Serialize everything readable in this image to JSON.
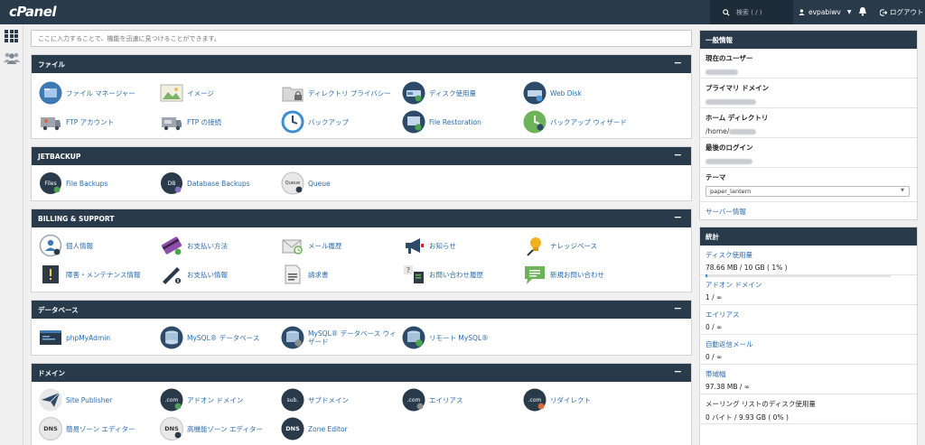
{
  "topbar": {
    "logo": "cPanel",
    "search_placeholder": "検索 ( / )",
    "username": "evpabiwv",
    "logout_label": "ログアウト"
  },
  "search": {
    "placeholder": "ここに入力することで、機能を迅速に見つけることができます。"
  },
  "panels": {
    "files": {
      "title": "ファイル",
      "items": [
        {
          "label": "ファイル マネージャー",
          "icon": "file-manager-icon"
        },
        {
          "label": "イメージ",
          "icon": "images-icon"
        },
        {
          "label": "ディレクトリ プライバシー",
          "icon": "directory-privacy-icon"
        },
        {
          "label": "ディスク使用量",
          "icon": "disk-usage-icon"
        },
        {
          "label": "Web Disk",
          "icon": "web-disk-icon"
        },
        {
          "label": "FTP アカウント",
          "icon": "ftp-accounts-icon"
        },
        {
          "label": "FTP の接続",
          "icon": "ftp-connections-icon"
        },
        {
          "label": "バックアップ",
          "icon": "backup-icon"
        },
        {
          "label": "File Restoration",
          "icon": "file-restoration-icon"
        },
        {
          "label": "バックアップ ウィザード",
          "icon": "backup-wizard-icon"
        }
      ]
    },
    "jetbackup": {
      "title": "JETBACKUP",
      "items": [
        {
          "label": "File Backups",
          "icon": "file-backups-icon",
          "badge": "Files"
        },
        {
          "label": "Database Backups",
          "icon": "database-backups-icon",
          "badge": "DB"
        },
        {
          "label": "Queue",
          "icon": "queue-icon",
          "badge": "Queue"
        }
      ]
    },
    "billing": {
      "title": "BILLING & SUPPORT",
      "items": [
        {
          "label": "個人情報",
          "icon": "personal-info-icon"
        },
        {
          "label": "お支払い方法",
          "icon": "payment-method-icon"
        },
        {
          "label": "メール履歴",
          "icon": "email-history-icon"
        },
        {
          "label": "お知らせ",
          "icon": "announcements-icon"
        },
        {
          "label": "ナレッジベース",
          "icon": "knowledgebase-icon"
        },
        {
          "label": "障害・メンテナンス情報",
          "icon": "network-status-icon"
        },
        {
          "label": "お支払い情報",
          "icon": "payment-info-icon"
        },
        {
          "label": "請求書",
          "icon": "invoices-icon"
        },
        {
          "label": "お問い合わせ履歴",
          "icon": "support-history-icon"
        },
        {
          "label": "新規お問い合わせ",
          "icon": "new-ticket-icon"
        }
      ]
    },
    "database": {
      "title": "データベース",
      "items": [
        {
          "label": "phpMyAdmin",
          "icon": "phpmyadmin-icon"
        },
        {
          "label": "MySQL® データベース",
          "icon": "mysql-databases-icon"
        },
        {
          "label": "MySQL® データベース ウィザード",
          "icon": "mysql-wizard-icon"
        },
        {
          "label": "リモート MySQL®",
          "icon": "remote-mysql-icon"
        }
      ]
    },
    "domains": {
      "title": "ドメイン",
      "items": [
        {
          "label": "Site Publisher",
          "icon": "site-publisher-icon"
        },
        {
          "label": "アドオン ドメイン",
          "icon": "addon-domains-icon",
          "badge": ".com"
        },
        {
          "label": "サブドメイン",
          "icon": "subdomains-icon",
          "badge": "sub."
        },
        {
          "label": "エイリアス",
          "icon": "aliases-icon",
          "badge": ".com"
        },
        {
          "label": "リダイレクト",
          "icon": "redirects-icon",
          "badge": ".com"
        },
        {
          "label": "簡易ゾーン エディター",
          "icon": "simple-zone-editor-icon",
          "badge": "DNS"
        },
        {
          "label": "高機能ゾーン エディター",
          "icon": "advanced-zone-editor-icon",
          "badge": "DNS"
        },
        {
          "label": "Zone Editor",
          "icon": "zone-editor-icon",
          "badge": "DNS"
        }
      ]
    }
  },
  "general_info": {
    "title": "一般情報",
    "current_user_label": "現在のユーザー",
    "primary_domain_label": "プライマリ ドメイン",
    "home_dir_label": "ホーム ディレクトリ",
    "home_dir_value": "/home/",
    "last_login_label": "最後のログイン",
    "theme_label": "テーマ",
    "theme_value": "paper_lantern",
    "server_info_link": "サーバー情報"
  },
  "stats": {
    "title": "統計",
    "rows": [
      {
        "label": "ディスク使用量",
        "value": "78.66 MB / 10 GB ( 1% )",
        "fraction": 0.01,
        "bar": true,
        "link": true
      },
      {
        "label": "アドオン ドメイン",
        "value": "1 / ∞",
        "bar": false,
        "link": true
      },
      {
        "label": "エイリアス",
        "value": "0 / ∞",
        "bar": false,
        "link": true
      },
      {
        "label": "自動返信メール",
        "value": "0 / ∞",
        "bar": false,
        "link": true
      },
      {
        "label": "帯域幅",
        "value": "97.38 MB / ∞",
        "bar": false,
        "link": true
      },
      {
        "label": "メーリング リストのディスク使用量",
        "value": "0 バイト / 9.93 GB ( 0% )",
        "bar": false,
        "link": false
      }
    ]
  },
  "colors": {
    "header": "#293a4a",
    "link": "#2b6cb0",
    "background": "#f0f0f0"
  }
}
